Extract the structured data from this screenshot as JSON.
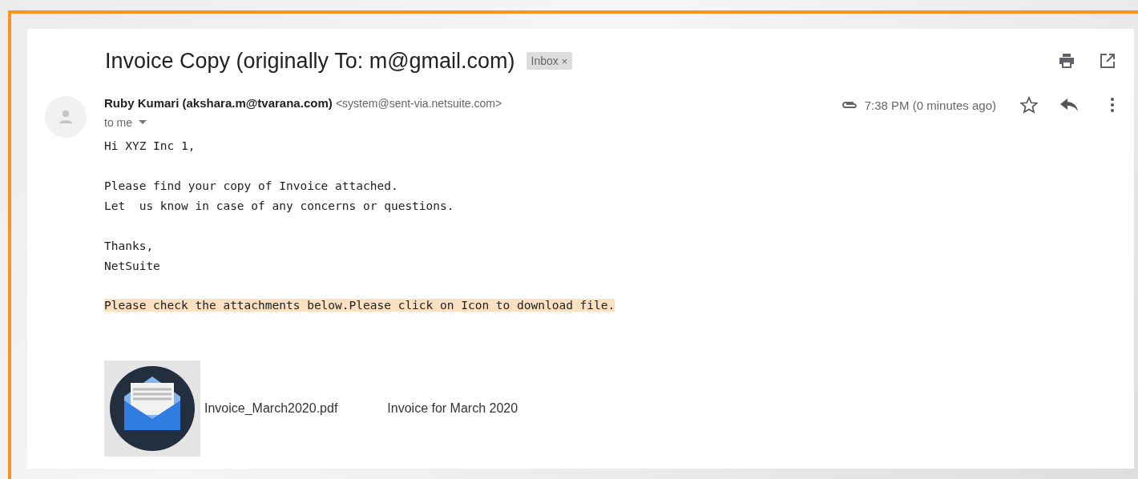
{
  "subject": "Invoice Copy (originally To: m@gmail.com)",
  "label": {
    "text": "Inbox",
    "remove": "×"
  },
  "sender": {
    "name": "Ruby Kumari (akshara.m@tvarana.com)",
    "address": "<system@sent-via.netsuite.com>",
    "recipient": "to me"
  },
  "time": "7:38 PM (0 minutes ago)",
  "starred": false,
  "body": [
    {
      "lines": [
        "Hi XYZ Inc 1,"
      ]
    },
    {
      "lines": [
        "Please find your copy of Invoice attached.",
        "Let  us know in case of any concerns or questions."
      ]
    },
    {
      "lines": [
        "Thanks,",
        "NetSuite"
      ]
    }
  ],
  "notice": "Please check the attachments below.Please click on Icon to download file.",
  "attachment": {
    "file": "Invoice_March2020.pdf",
    "description": "Invoice for March 2020"
  }
}
